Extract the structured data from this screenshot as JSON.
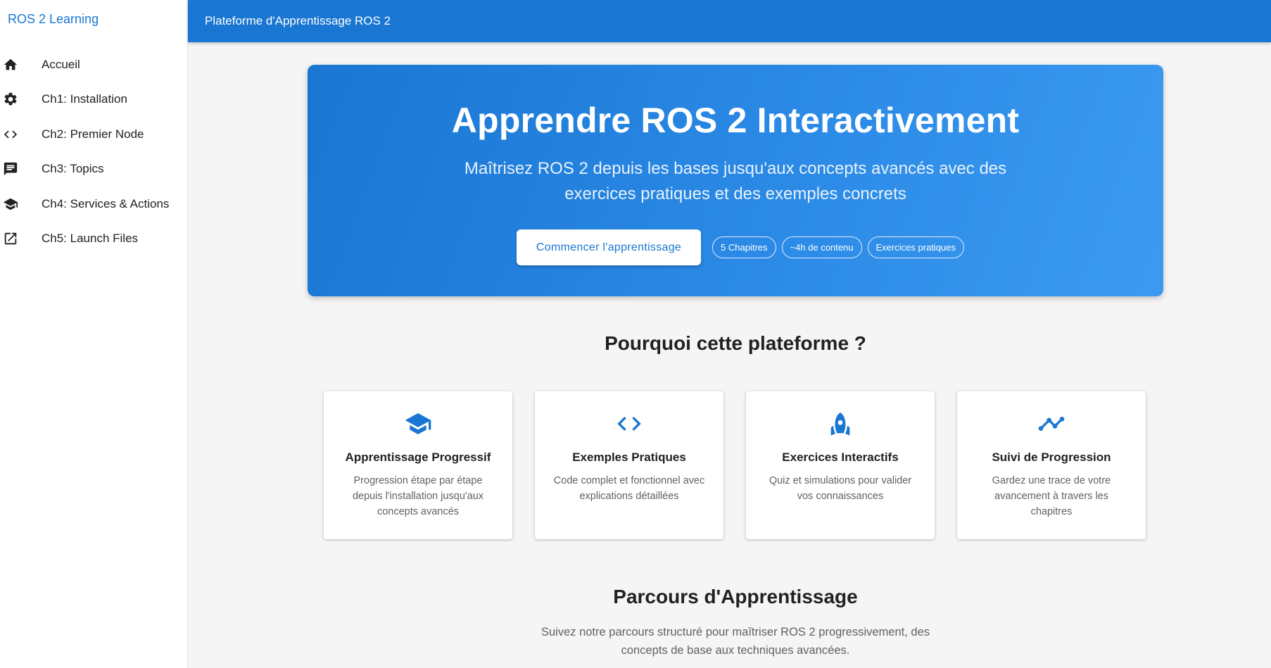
{
  "sidebar": {
    "brand": "ROS 2 Learning",
    "items": [
      {
        "label": "Accueil",
        "icon": "home-icon"
      },
      {
        "label": "Ch1: Installation",
        "icon": "gear-icon"
      },
      {
        "label": "Ch2: Premier Node",
        "icon": "code-icon"
      },
      {
        "label": "Ch3: Topics",
        "icon": "chat-icon"
      },
      {
        "label": "Ch4: Services & Actions",
        "icon": "school-icon"
      },
      {
        "label": "Ch5: Launch Files",
        "icon": "open-in-new-icon"
      }
    ]
  },
  "appbar": {
    "title": "Plateforme d'Apprentissage ROS 2",
    "color": "#1976d2"
  },
  "hero": {
    "title": "Apprendre ROS 2 Interactivement",
    "subtitle": "Maîtrisez ROS 2 depuis les bases jusqu'aux concepts avancés avec des exercices pratiques et des exemples concrets",
    "cta_label": "Commencer l'apprentissage",
    "chips": [
      "5 Chapitres",
      "~4h de contenu",
      "Exercices pratiques"
    ]
  },
  "features": {
    "title": "Pourquoi cette plateforme ?",
    "cards": [
      {
        "icon": "school-icon",
        "title": "Apprentissage Progressif",
        "text": "Progression étape par étape depuis l'installation jusqu'aux concepts avancés"
      },
      {
        "icon": "code-icon",
        "title": "Exemples Pratiques",
        "text": "Code complet et fonctionnel avec explications détaillées"
      },
      {
        "icon": "rocket-icon",
        "title": "Exercices Interactifs",
        "text": "Quiz et simulations pour valider vos connaissances"
      },
      {
        "icon": "trending-icon",
        "title": "Suivi de Progression",
        "text": "Gardez une trace de votre avancement à travers les chapitres"
      }
    ]
  },
  "path": {
    "title": "Parcours d'Apprentissage",
    "subtitle": "Suivez notre parcours structuré pour maîtriser ROS 2 progressivement, des concepts de base aux techniques avancées."
  }
}
